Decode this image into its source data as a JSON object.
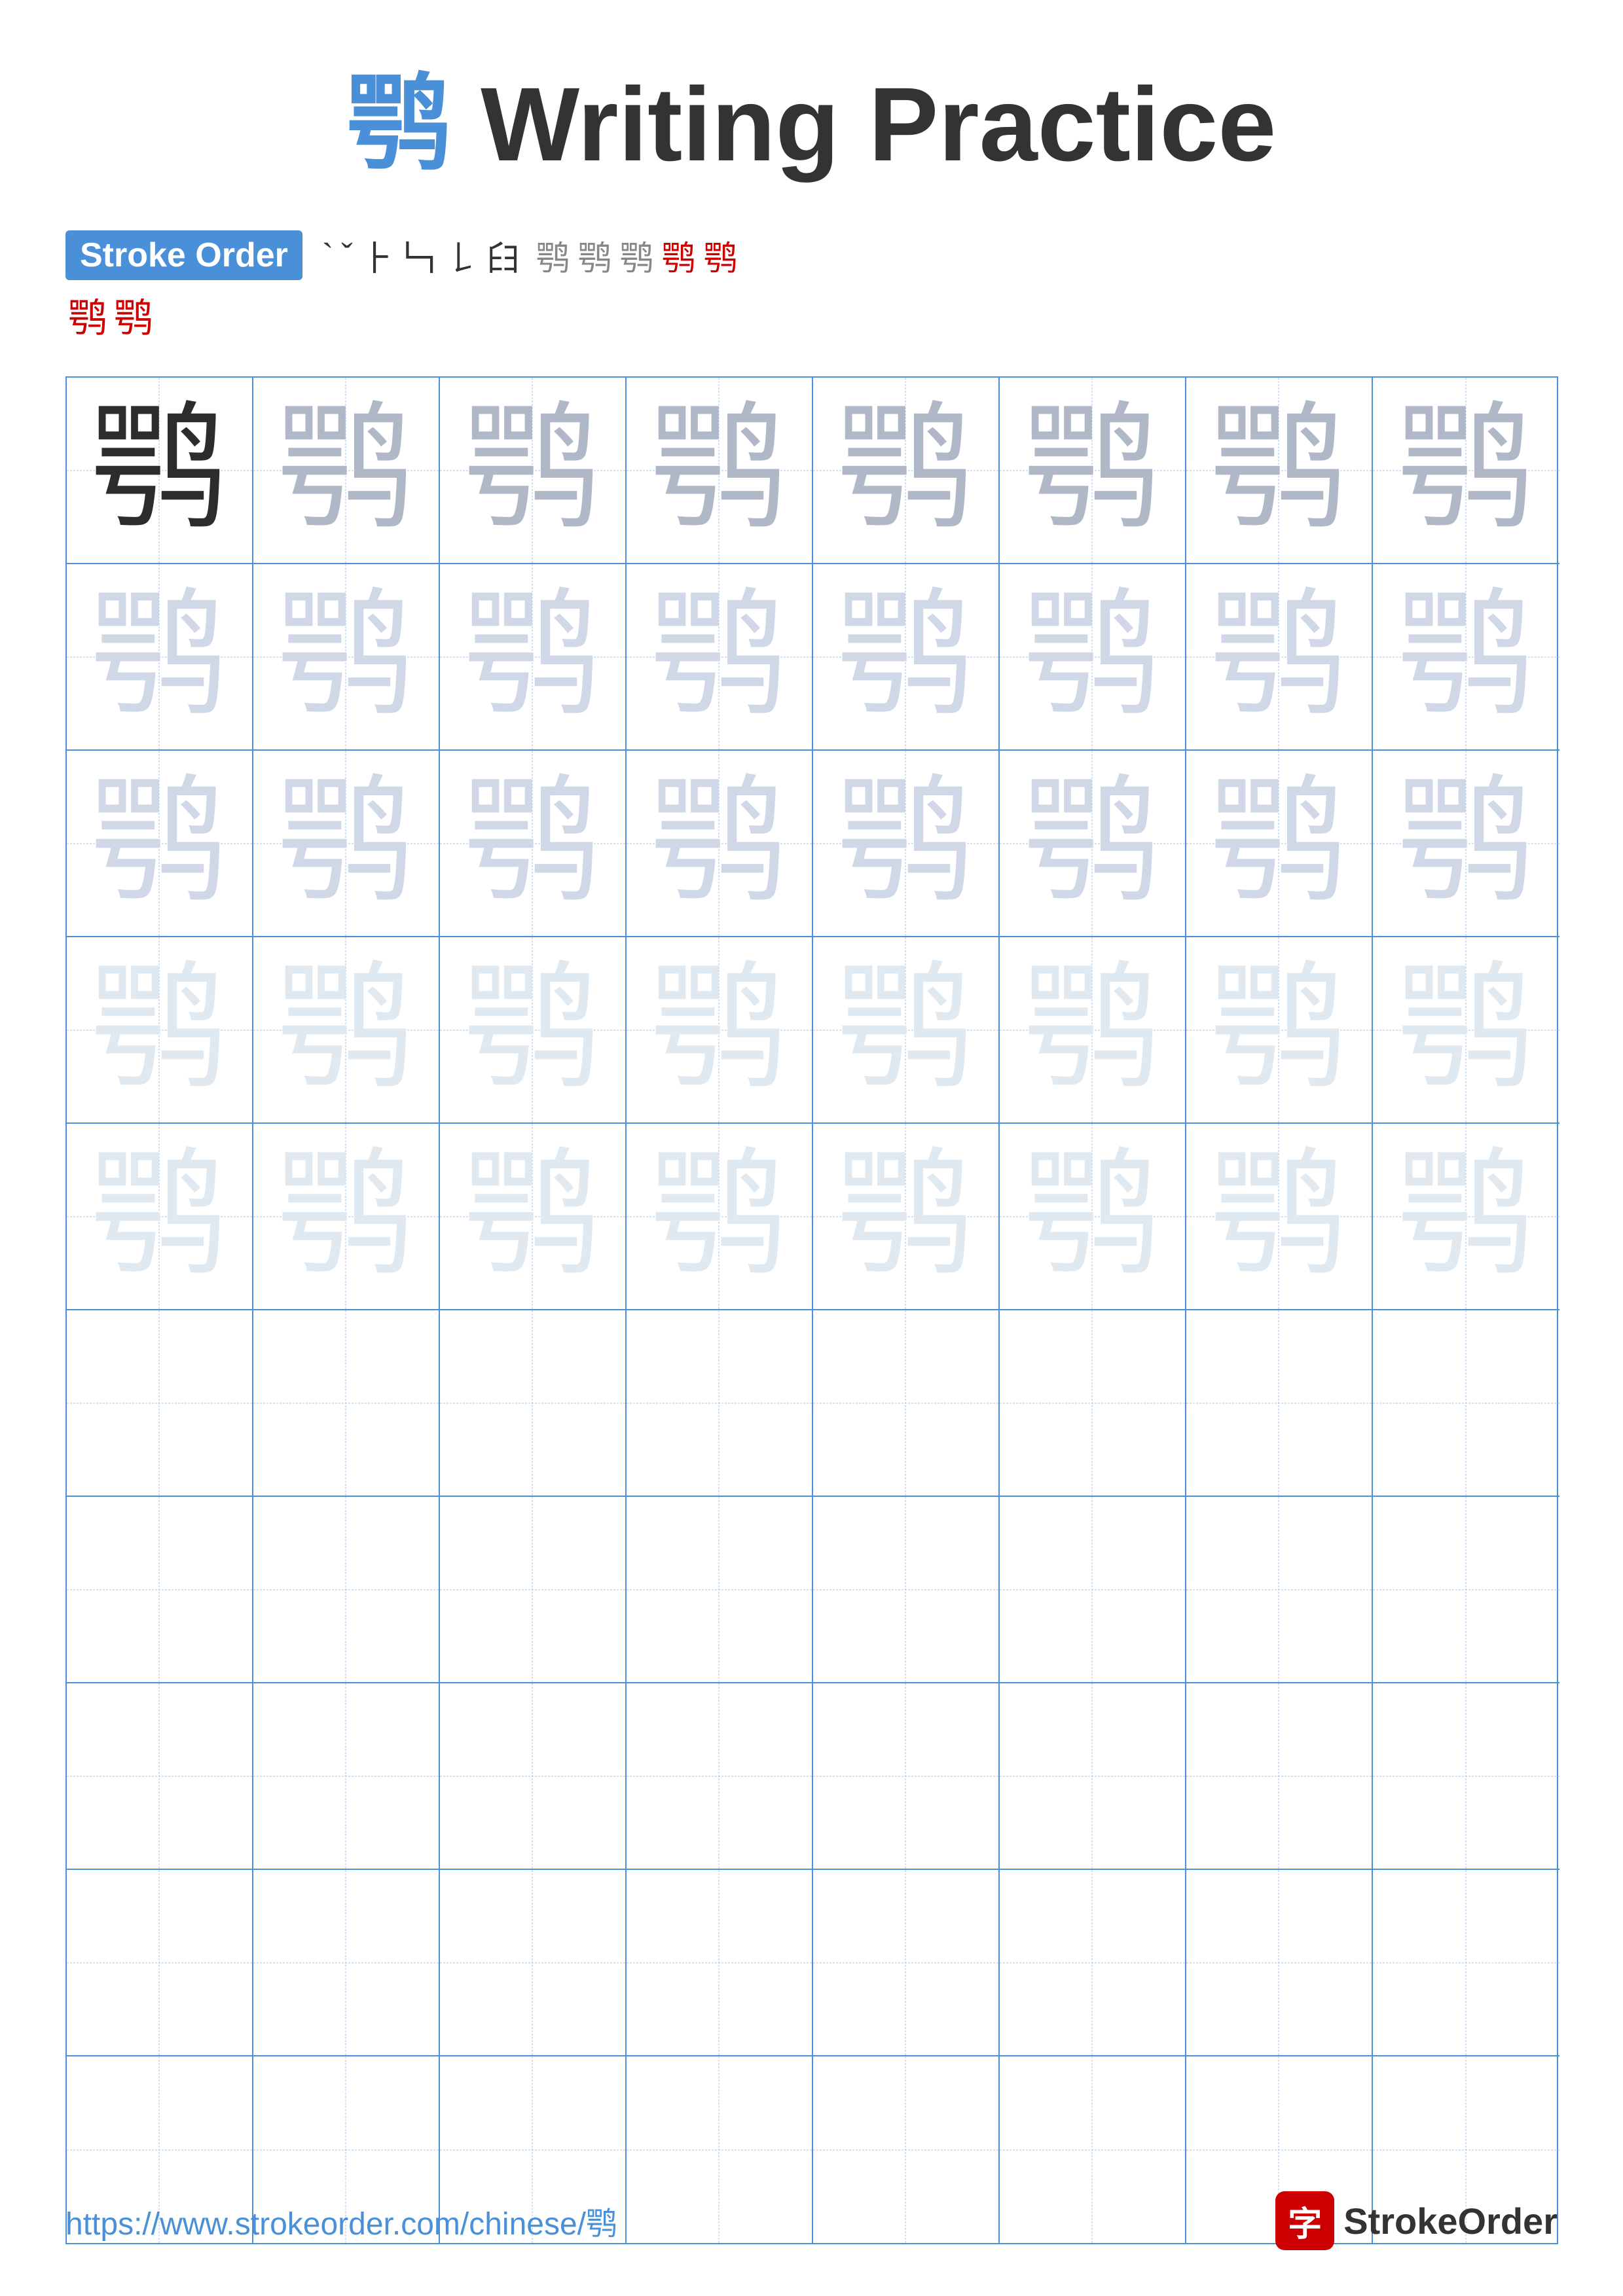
{
  "title": {
    "chinese": "鹗",
    "english": " Writing Practice"
  },
  "stroke_order": {
    "label": "Stroke Order",
    "strokes": [
      "`",
      "ˇ",
      "⺊",
      "𠃑",
      "𠃍𠃑",
      "𦥑𠃑",
      "𦥑𠃍𠃑",
      "𦢼𦥑𠃑",
      "𦢼𦥑𠃍𠃑",
      "𦢼𦥑𠃑𠃑",
      "鹗¹",
      "鹗²"
    ],
    "extra": [
      "鹗",
      "鹗"
    ]
  },
  "character": "鹗",
  "grid": {
    "rows": 10,
    "cols": 8
  },
  "footer": {
    "url": "https://www.strokeorder.com/chinese/鹗",
    "logo_char": "字",
    "logo_text": "StrokeOrder"
  }
}
